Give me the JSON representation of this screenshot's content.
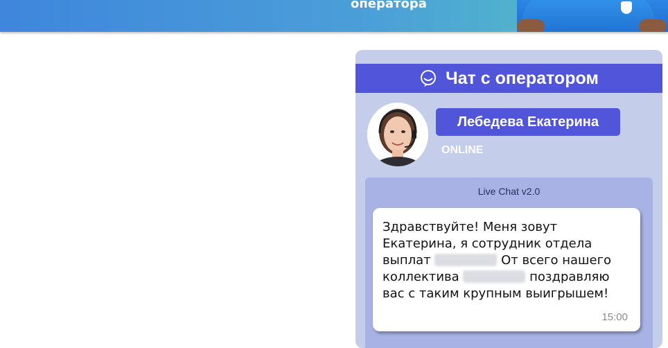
{
  "banner": {
    "text": "оператора"
  },
  "chat": {
    "title": "Чат с оператором",
    "operator_name": "Лебедева Екатерина",
    "status": "ONLINE",
    "version": "Live Chat v2.0",
    "message": {
      "line1": "Здравствуйте! Меня зовут",
      "line2": "Екатерина, я сотрудник отдела",
      "line3_before": "выплат",
      "line3_after": "От всего нашего",
      "line4_before": "коллектива",
      "line4_after": "поздравляю",
      "line5": "вас с таким крупным выигрышем!",
      "time": "15:00"
    }
  },
  "colors": {
    "header": "#5055d9",
    "widget_bg": "#c4cde9",
    "chat_body_bg": "#a9b2e4"
  },
  "icons": {
    "chat_header": "chat-bubble-icon"
  }
}
